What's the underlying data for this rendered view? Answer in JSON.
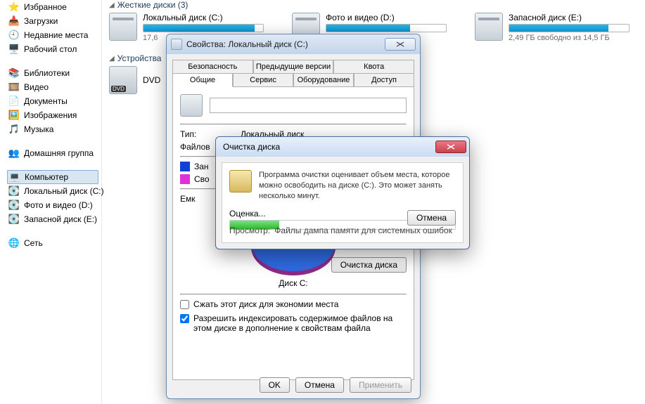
{
  "sidebar": {
    "fav": {
      "title": "Избранное",
      "items": [
        "Загрузки",
        "Недавние места",
        "Рабочий стол"
      ]
    },
    "lib": {
      "title": "Библиотеки",
      "items": [
        "Видео",
        "Документы",
        "Изображения",
        "Музыка"
      ]
    },
    "home": "Домашняя группа",
    "comp": {
      "title": "Компьютер",
      "items": [
        "Локальный диск (C:)",
        "Фото и видео (D:)",
        "Запасной диск (E:)"
      ]
    },
    "net": "Сеть"
  },
  "sections": {
    "hdd": "Жесткие диски (3)",
    "removable": "Устройства"
  },
  "drives": [
    {
      "name": "Локальный диск (C:)",
      "free": "17,6",
      "fill": 93
    },
    {
      "name": "Фото и видео (D:)",
      "free": "",
      "fill": 70
    },
    {
      "name": "Запасной диск (E:)",
      "free": "2,49 ГБ свободно из 14,5 ГБ",
      "fill": 83
    }
  ],
  "dvd": {
    "label": "DVD",
    "badge": "DVD"
  },
  "props": {
    "title": "Свойства: Локальный диск (C:)",
    "tabs_row1": [
      "Безопасность",
      "Предыдущие версии",
      "Квота"
    ],
    "tabs_row2": [
      "Общие",
      "Сервис",
      "Оборудование",
      "Доступ"
    ],
    "type_k": "Тип:",
    "type_v": "Локальный диск",
    "fs_k": "Файлов",
    "used_k": "Зан",
    "free_k": "Сво",
    "cap_k": "Емк",
    "diskC": "Диск C:",
    "cleanup": "Очистка диска",
    "chk1": "Сжать этот диск для экономии места",
    "chk2": "Разрешить индексировать содержимое файлов на этом диске в дополнение к свойствам файла",
    "ok": "OK",
    "cancel": "Отмена",
    "apply": "Применить"
  },
  "cleanup": {
    "title": "Очистка диска",
    "msg": "Программа очистки оценивает объем места, которое можно освободить на диске  (C:). Это может занять несколько минут.",
    "eval": "Оценка...",
    "view_k": "Просмотр:",
    "view_v": "Файлы дампа памяти для системных ошибок",
    "cancel": "Отмена"
  }
}
